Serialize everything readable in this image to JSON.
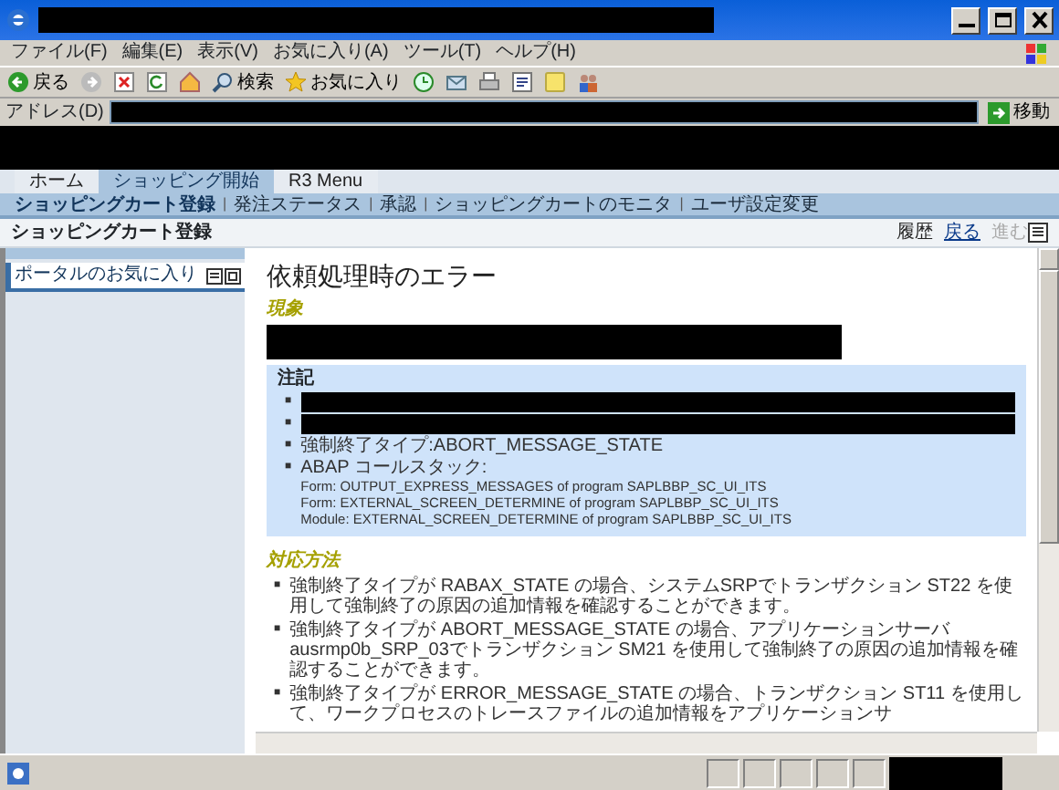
{
  "window": {
    "menu": [
      "ファイル(F)",
      "編集(E)",
      "表示(V)",
      "お気に入り(A)",
      "ツール(T)",
      "ヘルプ(H)"
    ],
    "toolbar": {
      "back": "戻る",
      "search": "検索",
      "favorites": "お気に入り"
    },
    "address": {
      "label": "アドレス(D)",
      "go": "移動"
    }
  },
  "portal": {
    "separator": "|",
    "bullet": "■",
    "tabs": [
      {
        "label": "ホーム",
        "selected": false
      },
      {
        "label": "ショッピング開始",
        "selected": true
      },
      {
        "label": "R3 Menu",
        "selected": false
      }
    ],
    "subnav": [
      {
        "label": "ショッピングカート登録",
        "selected": true
      },
      {
        "label": "発注ステータス",
        "selected": false
      },
      {
        "label": "承認",
        "selected": false
      },
      {
        "label": "ショッピングカートのモニタ",
        "selected": false
      },
      {
        "label": "ユーザ設定変更",
        "selected": false
      }
    ],
    "page_title": "ショッピングカート登録",
    "history": "履歴",
    "back": "戻る",
    "forward": {
      "label": "進む",
      "disabled": true
    }
  },
  "sidebar": {
    "title": "ポータルのお気に入り"
  },
  "content": {
    "title": "依頼処理時のエラー",
    "symptom_heading": "現象",
    "note": {
      "heading": "注記",
      "items": [
        {
          "kind": "redacted"
        },
        {
          "kind": "redacted"
        },
        {
          "kind": "text",
          "text": "強制終了タイプ:ABORT_MESSAGE_STATE"
        },
        {
          "kind": "stack",
          "text": "ABAP コールスタック:",
          "lines": [
            "Form: OUTPUT_EXPRESS_MESSAGES of program SAPLBBP_SC_UI_ITS",
            "Form: EXTERNAL_SCREEN_DETERMINE of program SAPLBBP_SC_UI_ITS",
            "Module: EXTERNAL_SCREEN_DETERMINE of program SAPLBBP_SC_UI_ITS"
          ]
        }
      ]
    },
    "solution_heading": "対応方法",
    "solutions": [
      "強制終了タイプが RABAX_STATE の場合、システムSRPでトランザクション ST22 を使用して強制終了の原因の追加情報を確認することができます。",
      "強制終了タイプが ABORT_MESSAGE_STATE の場合、アプリケーションサーバausrmp0b_SRP_03でトランザクション SM21 を使用して強制終了の原因の追加情報を確認することができます。",
      "強制終了タイプが ERROR_MESSAGE_STATE の場合、トランザクション ST11 を使用して、ワークプロセスのトレースファイルの追加情報をアプリケーションサ"
    ]
  }
}
